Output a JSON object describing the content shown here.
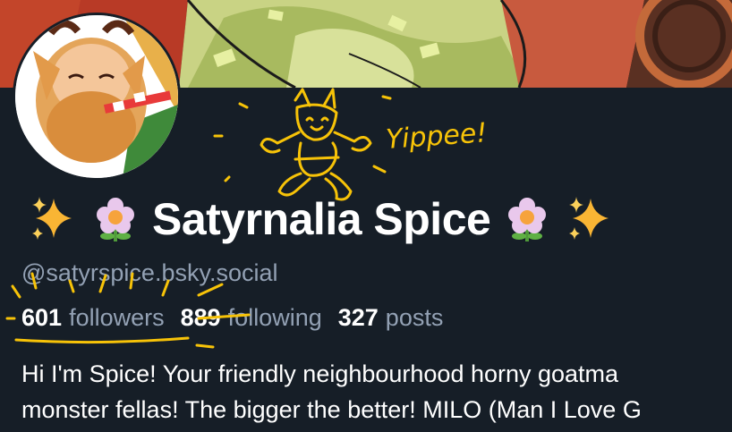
{
  "profile": {
    "display_name": "Satyrnalia Spice",
    "handle": "@satyrspice.bsky.social",
    "followers_count": "601",
    "followers_label": "followers",
    "following_count": "889",
    "following_label": "following",
    "posts_count": "327",
    "posts_label": "posts",
    "bio_lines": [
      "Hi I'm Spice! Your friendly neighbourhood horny goatma",
      "monster fellas! The bigger the better! MILO (Man I Love G"
    ],
    "name_emojis": [
      "sparkles-icon",
      "flower-icon",
      "flower-icon",
      "sparkles-icon"
    ]
  },
  "doodle": {
    "text": "Yippee!",
    "color": "#f7c308"
  },
  "colors": {
    "background": "#161e27",
    "muted_text": "#93a1b4",
    "primary_text": "#ffffff",
    "accent": "#f7c308"
  }
}
